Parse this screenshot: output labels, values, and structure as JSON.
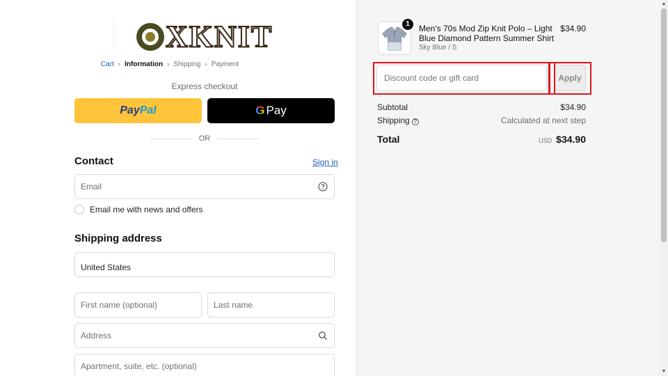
{
  "brand": {
    "logo_text": "XKNIT"
  },
  "breadcrumb": {
    "items": [
      {
        "label": "Cart",
        "state": "link"
      },
      {
        "label": "Information",
        "state": "current"
      },
      {
        "label": "Shipping",
        "state": "upcoming"
      },
      {
        "label": "Payment",
        "state": "upcoming"
      }
    ],
    "separator": "›"
  },
  "express_checkout": {
    "label": "Express checkout",
    "paypal": {
      "part1": "Pay",
      "part2": "Pal"
    },
    "gpay": {
      "g": "G",
      "label": "Pay"
    },
    "divider": "OR"
  },
  "contact": {
    "heading": "Contact",
    "sign_in": "Sign in",
    "email_placeholder": "Email",
    "newsletter_label": "Email me with news and offers"
  },
  "shipping": {
    "heading": "Shipping address",
    "country_value": "United States",
    "first_name_placeholder": "First name (optional)",
    "last_name_placeholder": "Last name",
    "address_placeholder": "Address",
    "apartment_placeholder": "Apartment, suite, etc. (optional)"
  },
  "order": {
    "item": {
      "quantity": "1",
      "title": "Men's 70s Mod Zip Knit Polo – Light Blue Diamond Pattern Summer Shirt",
      "variant": "Sky Blue / S",
      "price": "$34.90"
    },
    "discount": {
      "placeholder": "Discount code or gift card",
      "apply_label": "Apply"
    },
    "subtotal": {
      "label": "Subtotal",
      "value": "$34.90"
    },
    "shipping": {
      "label": "Shipping",
      "value": "Calculated at next step"
    },
    "total": {
      "label": "Total",
      "currency": "USD",
      "value": "$34.90"
    }
  },
  "colors": {
    "accent_link": "#1a5fb4",
    "paypal_yellow": "#ffc439",
    "highlight_red": "#e0141c"
  }
}
